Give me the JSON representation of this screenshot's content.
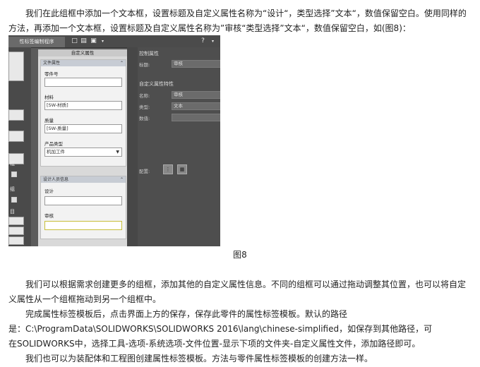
{
  "paragraphs": {
    "p1": "我们在此组框中添加一个文本框，设置标题及自定义属性名称为“设计“，类型选择”文本“，数值保留空白。使用同样的方法，再添加一个文本框，设置标题及自定义属性名称为”审核“类型选择”文本“，数值保留空白，如(图8)：",
    "caption": "图8",
    "p2": "我们可以根据需求创建更多的组框，添加其他的自定义属性信息。不同的组框可以通过拖动调整其位置，也可以将自定义属性从一个组框拖动到另一个组框中。",
    "p3": "完成属性标签模板后，点击界面上方的保存，保存此零件的属性标签模板。默认的路径",
    "p4": "是：C:\\ProgramData\\SOLIDWORKS\\SOLIDWORKS 2016\\lang\\chinese-simplified，如保存到其他路径，可",
    "p5": "在SOLIDWORKS中，选择工具-选项-系统选项-文件位置-显示下项的文件夹-自定义属性文件，添加路径即可。",
    "p6": "我们也可以为装配体和工程图创建属性标签模板。方法与零件属性标签模板的创建方法一样。"
  },
  "screenshot": {
    "tab_label": "性标签编制程序",
    "help_label": "?",
    "left_labels": [
      "框",
      "组",
      "目"
    ],
    "center": {
      "header": "自定义属性",
      "group1_title": "文件属性",
      "group1_fields": [
        {
          "label": "零件号",
          "value": ""
        },
        {
          "label": "材料",
          "value": "[SW-材质]"
        },
        {
          "label": "质量",
          "value": "[SW-质量]"
        },
        {
          "label": "产品类型",
          "value": "机加工件"
        }
      ],
      "group2_title": "设计人员信息",
      "group2_fields": [
        {
          "label": "设计",
          "value": ""
        },
        {
          "label": "审核",
          "value": ""
        }
      ]
    },
    "right": {
      "section1": "控制属性",
      "label_title": "标题:",
      "value_title": "审核",
      "section2": "自定义属性特性",
      "label_name": "名称:",
      "value_name": "审核",
      "label_type": "类型:",
      "value_type": "文本",
      "label_value": "数值:",
      "value_value": "",
      "label_config": "配置:"
    }
  }
}
